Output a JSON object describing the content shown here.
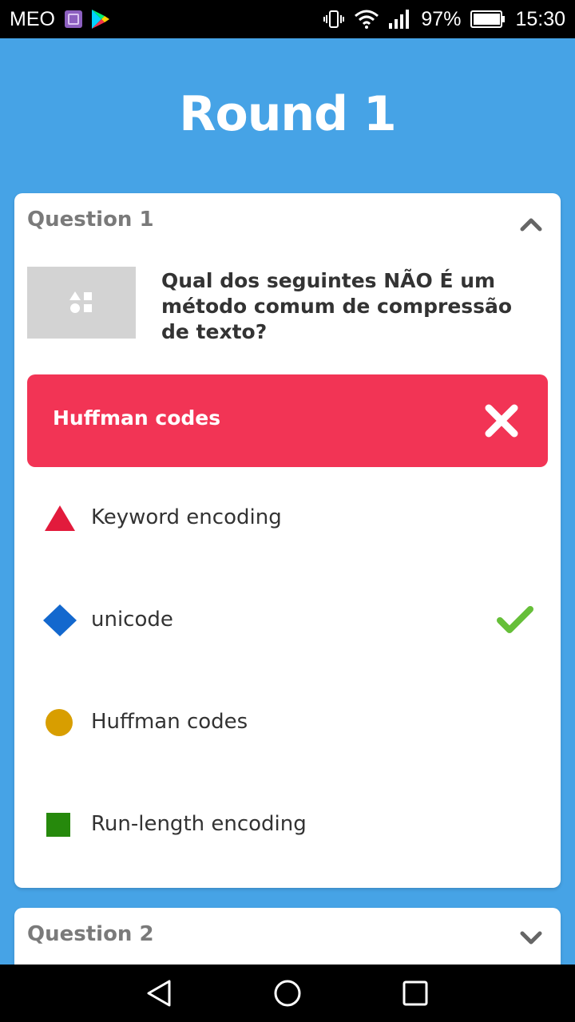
{
  "status_bar": {
    "carrier": "MEO",
    "battery": "97%",
    "time": "15:30"
  },
  "header": {
    "title": "Round 1"
  },
  "questions": [
    {
      "label": "Question 1",
      "expanded": true,
      "text": "Qual dos seguintes NÃO É um método comum de compressão de texto?",
      "selected_answer": "Huffman codes",
      "selected_correct": false,
      "options": [
        {
          "label": "Keyword encoding",
          "shape": "triangle",
          "color": "#e21b3c",
          "correct": false
        },
        {
          "label": "unicode",
          "shape": "diamond",
          "color": "#1368ce",
          "correct": true
        },
        {
          "label": "Huffman codes",
          "shape": "circle",
          "color": "#d89e00",
          "correct": false
        },
        {
          "label": "Run-length encoding",
          "shape": "square",
          "color": "#26890c",
          "correct": false
        }
      ]
    },
    {
      "label": "Question 2",
      "expanded": false
    }
  ],
  "colors": {
    "background": "#46a3e6",
    "wrong_answer": "#f23455",
    "check": "#66bf39"
  },
  "icons": {
    "collapse": "chevron-up-icon",
    "expand": "chevron-down-icon",
    "image_placeholder": "shapes-placeholder-icon",
    "wrong": "close-icon",
    "correct": "checkmark-icon"
  }
}
